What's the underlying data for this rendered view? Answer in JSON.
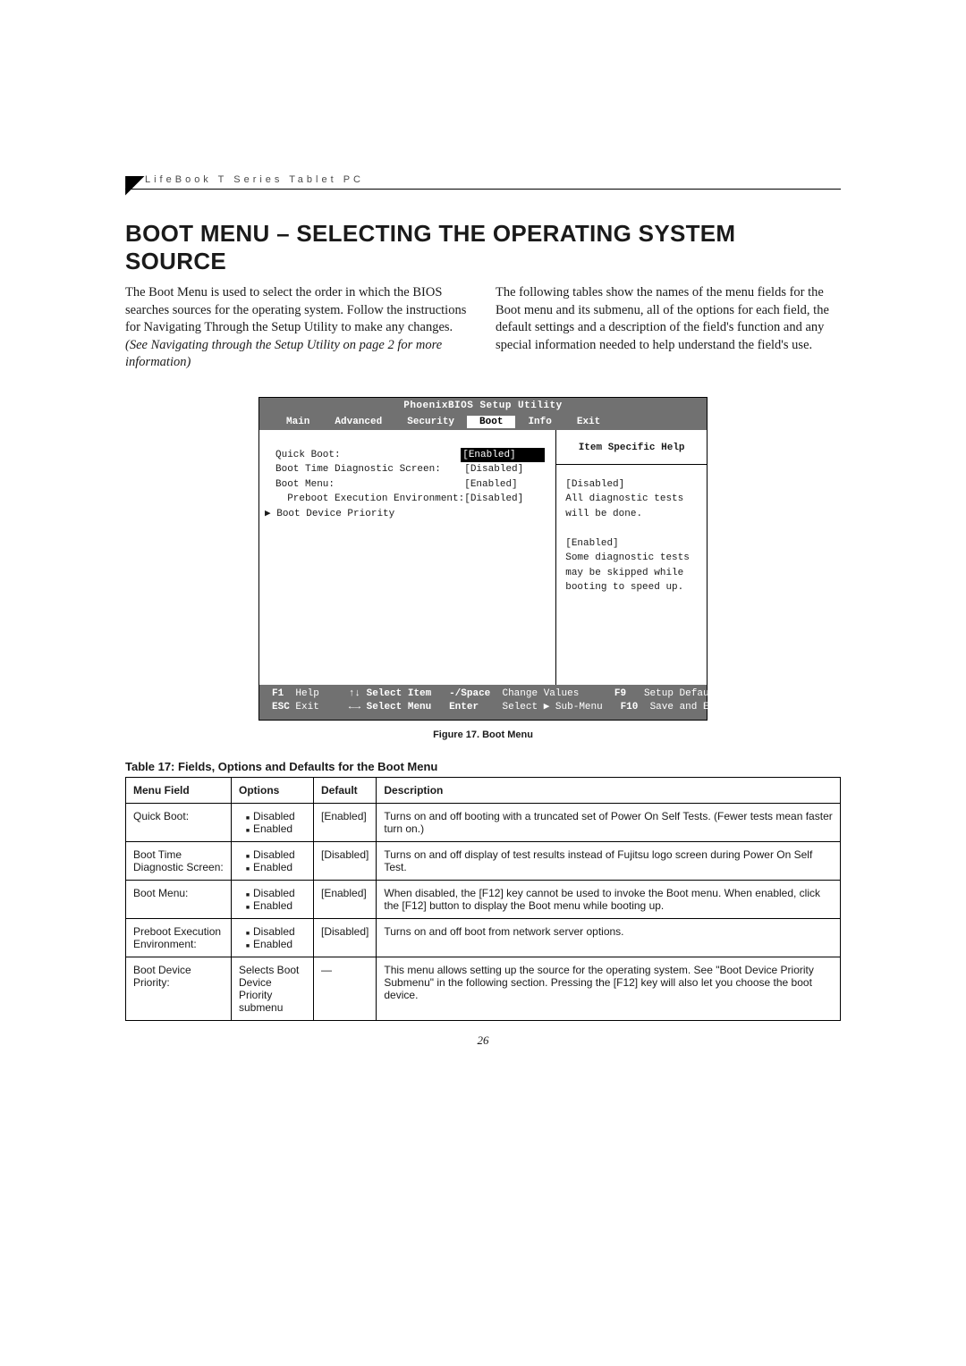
{
  "header": {
    "running_head": "LifeBook T Series Tablet PC"
  },
  "title": "BOOT MENU – SELECTING THE OPERATING SYSTEM SOURCE",
  "intro": {
    "left_a": "The Boot Menu is used to select the order in which the BIOS searches sources for the operating system. Follow the instructions for Navigating Through the Setup Utility to make any changes. ",
    "left_b": "(See Navigating through the Setup Utility on page 2 for more information)",
    "right": "The following tables show the names of the menu fields for the Boot menu and its submenu, all of the options for each field, the default settings and a description of the field's function and any special information needed to help understand the field's use."
  },
  "bios": {
    "title": "PhoenixBIOS Setup Utility",
    "menus": [
      "Main",
      "Advanced",
      "Security",
      "Boot",
      "Info",
      "Exit"
    ],
    "selected_menu": "Boot",
    "items": [
      {
        "label": "Quick Boot:",
        "value": "[Enabled]",
        "hl": true
      },
      {
        "label": "Boot Time Diagnostic Screen:",
        "value": "[Disabled]",
        "hl": false
      },
      {
        "label": "Boot Menu:",
        "value": "[Enabled]",
        "hl": false
      },
      {
        "label": "  Preboot Execution Environment:",
        "value": "[Disabled]",
        "hl": false
      },
      {
        "label": "▶ Boot Device Priority",
        "value": "",
        "hl": false,
        "sub": true
      }
    ],
    "help_title": "Item Specific Help",
    "help_body_1": "[Disabled]",
    "help_body_2": "All diagnostic tests will be done.",
    "help_body_3": "[Enabled]",
    "help_body_4": "Some diagnostic tests may be skipped while booting to speed up.",
    "foot": {
      "f1": "F1",
      "f1l": "Help",
      "esc": "ESC",
      "escl": "Exit",
      "si": "↑↓ Select Item",
      "sm": "←→ Select Menu",
      "cv_k": "-/Space",
      "cv_l": "Change Values",
      "en_k": "Enter",
      "en_l": "Select ▶ Sub-Menu",
      "f9": "F9",
      "f9l": "Setup Defaults",
      "f10": "F10",
      "f10l": "Save and Exit"
    }
  },
  "fig_caption": "Figure 17.  Boot Menu",
  "table_caption": "Table 17: Fields, Options and Defaults for the Boot Menu",
  "table_headers": [
    "Menu Field",
    "Options",
    "Default",
    "Description"
  ],
  "table_rows": [
    {
      "field": "Quick Boot:",
      "options": [
        "Disabled",
        "Enabled"
      ],
      "default": "[Enabled]",
      "desc": "Turns on and off booting with a truncated set of Power On Self Tests. (Fewer tests mean faster turn on.)"
    },
    {
      "field": "Boot Time Diagnostic Screen:",
      "options": [
        "Disabled",
        "Enabled"
      ],
      "default": "[Disabled]",
      "desc": "Turns on and off display of test results instead of Fujitsu logo screen during Power On Self Test."
    },
    {
      "field": "Boot Menu:",
      "options": [
        "Disabled",
        "Enabled"
      ],
      "default": "[Enabled]",
      "desc": "When disabled, the [F12] key cannot be used to invoke the Boot menu. When enabled, click the [F12] button to display the Boot menu while booting up."
    },
    {
      "field": "Preboot Execution Environment:",
      "options": [
        "Disabled",
        "Enabled"
      ],
      "default": "[Disabled]",
      "desc": "Turns on and off boot from network server options."
    },
    {
      "field": "Boot Device Priority:",
      "options_text": "Selects Boot Device Priority submenu",
      "default": "—",
      "desc": "This menu allows setting up the source for the operating system. See \"Boot Device Priority Submenu\" in the following section. Pressing the [F12] key will also let you choose the boot device."
    }
  ],
  "page_number": "26"
}
